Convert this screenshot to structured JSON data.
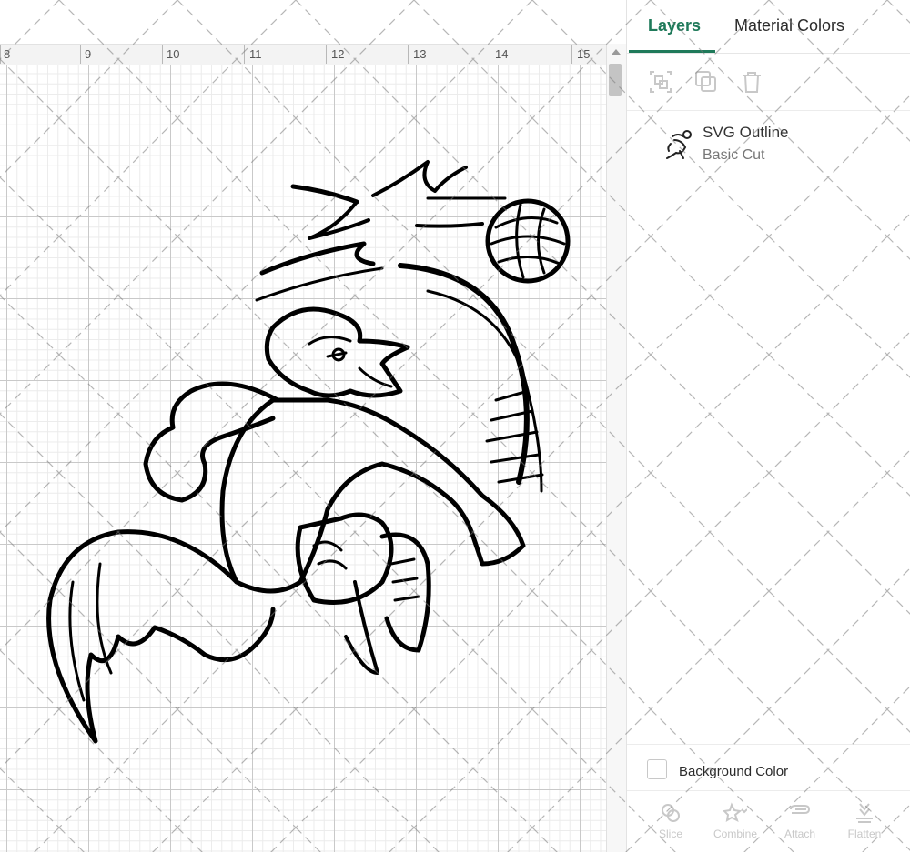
{
  "ruler": {
    "labels": [
      "8",
      "9",
      "10",
      "11",
      "12",
      "13",
      "14",
      "15"
    ]
  },
  "side_panel": {
    "tabs": [
      {
        "label": "Layers",
        "active": true
      },
      {
        "label": "Material Colors",
        "active": false
      }
    ],
    "toolbar": {
      "icons": [
        "group-icon",
        "duplicate-icon",
        "delete-icon"
      ]
    },
    "layers": [
      {
        "name": "SVG Outline",
        "operation": "Basic Cut",
        "thumb_icon": "roadrunner-thumbnail"
      }
    ],
    "background": {
      "label": "Background Color",
      "checked": false
    },
    "bottom_actions": [
      {
        "label": "Slice",
        "icon": "slice-icon"
      },
      {
        "label": "Combine",
        "icon": "combine-icon"
      },
      {
        "label": "Attach",
        "icon": "attach-icon"
      },
      {
        "label": "Flatten",
        "icon": "flatten-icon"
      }
    ]
  },
  "colors": {
    "accent": "#1f7a5a",
    "grid_major": "#c9c9c9",
    "grid_minor": "#ebebeb",
    "disabled": "#c8c8c8"
  }
}
